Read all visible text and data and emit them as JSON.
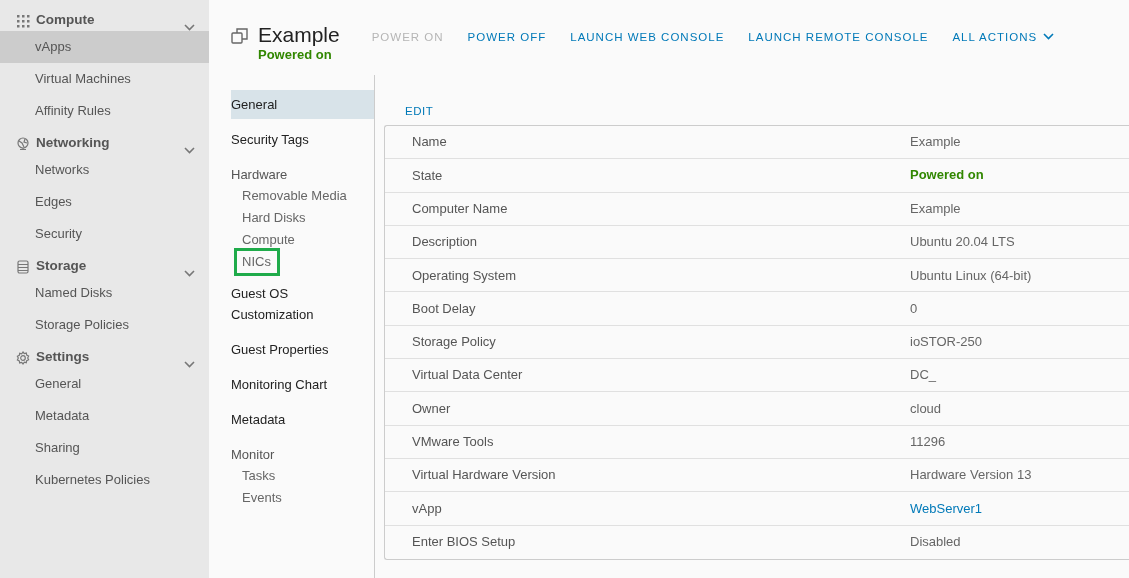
{
  "sidebar": {
    "groups": [
      {
        "label": "Compute",
        "expanded": true,
        "items": [
          {
            "label": "vApps",
            "selected": true
          },
          {
            "label": "Virtual Machines",
            "selected": false
          },
          {
            "label": "Affinity Rules",
            "selected": false
          }
        ]
      },
      {
        "label": "Networking",
        "expanded": true,
        "items": [
          {
            "label": "Networks",
            "selected": false
          },
          {
            "label": "Edges",
            "selected": false
          },
          {
            "label": "Security",
            "selected": false
          }
        ]
      },
      {
        "label": "Storage",
        "expanded": true,
        "items": [
          {
            "label": "Named Disks",
            "selected": false
          },
          {
            "label": "Storage Policies",
            "selected": false
          }
        ]
      },
      {
        "label": "Settings",
        "expanded": true,
        "items": [
          {
            "label": "General",
            "selected": false
          },
          {
            "label": "Metadata",
            "selected": false
          },
          {
            "label": "Sharing",
            "selected": false
          },
          {
            "label": "Kubernetes Policies",
            "selected": false
          }
        ]
      }
    ]
  },
  "header": {
    "title": "Example",
    "status": "Powered on",
    "actions": [
      {
        "label": "POWER ON",
        "disabled": true,
        "kind": "link"
      },
      {
        "label": "POWER OFF",
        "disabled": false,
        "kind": "link"
      },
      {
        "label": "LAUNCH WEB CONSOLE",
        "disabled": false,
        "kind": "link"
      },
      {
        "label": "LAUNCH REMOTE CONSOLE",
        "disabled": false,
        "kind": "link"
      },
      {
        "label": "ALL ACTIONS",
        "disabled": false,
        "kind": "dropdown"
      }
    ]
  },
  "subnav": [
    {
      "label": "General",
      "selected": true
    },
    {
      "label": "Security Tags",
      "selected": false
    },
    {
      "label": "Hardware",
      "selected": false,
      "children": [
        {
          "label": "Removable Media",
          "selected": false,
          "highlighted": false
        },
        {
          "label": "Hard Disks",
          "selected": false,
          "highlighted": false
        },
        {
          "label": "Compute",
          "selected": false,
          "highlighted": false
        },
        {
          "label": "NICs",
          "selected": false,
          "highlighted": true
        }
      ]
    },
    {
      "label": "Guest OS Customization",
      "selected": false
    },
    {
      "label": "Guest Properties",
      "selected": false
    },
    {
      "label": "Monitoring Chart",
      "selected": false
    },
    {
      "label": "Metadata",
      "selected": false
    },
    {
      "label": "Monitor",
      "selected": false,
      "children": [
        {
          "label": "Tasks",
          "selected": false,
          "highlighted": false
        },
        {
          "label": "Events",
          "selected": false,
          "highlighted": false
        }
      ]
    }
  ],
  "edit_button": "EDIT",
  "properties": [
    {
      "name": "Name",
      "value": "Example",
      "kind": "text"
    },
    {
      "name": "State",
      "value": "Powered on",
      "kind": "status"
    },
    {
      "name": "Computer Name",
      "value": "Example",
      "kind": "text"
    },
    {
      "name": "Description",
      "value": "Ubuntu 20.04 LTS",
      "kind": "text"
    },
    {
      "name": "Operating System",
      "value": "Ubuntu Linux (64-bit)",
      "kind": "text"
    },
    {
      "name": "Boot Delay",
      "value": "0",
      "kind": "text"
    },
    {
      "name": "Storage Policy",
      "value": "ioSTOR-250",
      "kind": "text"
    },
    {
      "name": "Virtual Data Center",
      "value": "DC_",
      "kind": "text"
    },
    {
      "name": "Owner",
      "value": "cloud",
      "kind": "text"
    },
    {
      "name": "VMware Tools",
      "value": "11296",
      "kind": "text"
    },
    {
      "name": "Virtual Hardware Version",
      "value": "Hardware Version 13",
      "kind": "text"
    },
    {
      "name": "vApp",
      "value": "WebServer1",
      "kind": "link"
    },
    {
      "name": "Enter BIOS Setup",
      "value": "Disabled",
      "kind": "text"
    }
  ]
}
